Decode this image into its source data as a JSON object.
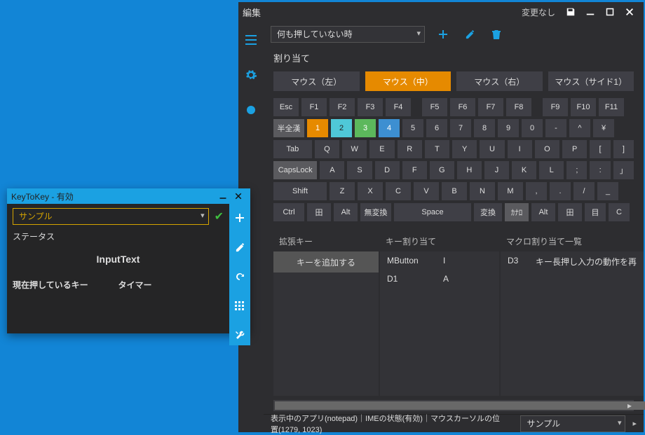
{
  "main": {
    "title": "編集",
    "change_status": "変更なし",
    "toolbar": {
      "layer_select": "何も押していない時"
    },
    "section_title": "割り当て",
    "mouse_tabs": {
      "left": "マウス（左）",
      "middle": "マウス（中）",
      "right": "マウス（右）",
      "side1": "マウス（サイド1）"
    },
    "keyboard": {
      "rows": [
        [
          {
            "l": "Esc",
            "w": 36
          },
          {
            "l": "F1",
            "w": 36
          },
          {
            "l": "F2",
            "w": 36
          },
          {
            "l": "F3",
            "w": 36
          },
          {
            "l": "F4",
            "w": 36
          },
          {
            "gap": 8
          },
          {
            "l": "F5",
            "w": 36
          },
          {
            "l": "F6",
            "w": 36
          },
          {
            "l": "F7",
            "w": 36
          },
          {
            "l": "F8",
            "w": 36
          },
          {
            "gap": 8
          },
          {
            "l": "F9",
            "w": 36
          },
          {
            "l": "F10",
            "w": 36
          },
          {
            "l": "F11",
            "w": 36
          }
        ],
        [
          {
            "l": "半全漢",
            "w": 44,
            "c": "light"
          },
          {
            "l": "1",
            "w": 30,
            "c": "orange"
          },
          {
            "l": "2",
            "w": 30,
            "c": "cyan"
          },
          {
            "l": "3",
            "w": 30,
            "c": "green"
          },
          {
            "l": "4",
            "w": 30,
            "c": "blue"
          },
          {
            "l": "5",
            "w": 30
          },
          {
            "l": "6",
            "w": 30
          },
          {
            "l": "7",
            "w": 30
          },
          {
            "l": "8",
            "w": 30
          },
          {
            "l": "9",
            "w": 30
          },
          {
            "l": "0",
            "w": 30
          },
          {
            "l": "-",
            "w": 30
          },
          {
            "l": "^",
            "w": 30
          },
          {
            "l": "¥",
            "w": 30
          }
        ],
        [
          {
            "l": "Tab",
            "w": 56
          },
          {
            "l": "Q",
            "w": 36
          },
          {
            "l": "W",
            "w": 36
          },
          {
            "l": "E",
            "w": 36
          },
          {
            "l": "R",
            "w": 36
          },
          {
            "l": "T",
            "w": 36
          },
          {
            "l": "Y",
            "w": 36
          },
          {
            "l": "U",
            "w": 36
          },
          {
            "l": "I",
            "w": 36
          },
          {
            "l": "O",
            "w": 36
          },
          {
            "l": "P",
            "w": 36
          },
          {
            "l": "[",
            "w": 30
          },
          {
            "l": "]",
            "w": 30
          }
        ],
        [
          {
            "l": "CapsLock",
            "w": 64,
            "c": "light"
          },
          {
            "l": "A",
            "w": 36
          },
          {
            "l": "S",
            "w": 36
          },
          {
            "l": "D",
            "w": 36
          },
          {
            "l": "F",
            "w": 36
          },
          {
            "l": "G",
            "w": 36
          },
          {
            "l": "H",
            "w": 36
          },
          {
            "l": "J",
            "w": 36
          },
          {
            "l": "K",
            "w": 36
          },
          {
            "l": "L",
            "w": 36
          },
          {
            "l": ";",
            "w": 30
          },
          {
            "l": ":",
            "w": 30
          },
          {
            "l": "」",
            "w": 30
          }
        ],
        [
          {
            "l": "Shift",
            "w": 76
          },
          {
            "l": "Z",
            "w": 36
          },
          {
            "l": "X",
            "w": 36
          },
          {
            "l": "C",
            "w": 36
          },
          {
            "l": "V",
            "w": 36
          },
          {
            "l": "B",
            "w": 36
          },
          {
            "l": "N",
            "w": 36
          },
          {
            "l": "M",
            "w": 36
          },
          {
            "l": ",",
            "w": 30
          },
          {
            "l": ".",
            "w": 30
          },
          {
            "l": "/",
            "w": 30
          },
          {
            "l": "_",
            "w": 30
          }
        ],
        [
          {
            "l": "Ctrl",
            "w": 44
          },
          {
            "l": "田",
            "w": 34
          },
          {
            "l": "Alt",
            "w": 34
          },
          {
            "l": "無変換",
            "w": 44
          },
          {
            "l": "Space",
            "w": 110
          },
          {
            "l": "変換",
            "w": 40
          },
          {
            "l": "ｶﾅﾛ",
            "w": 34,
            "c": "light"
          },
          {
            "l": "Alt",
            "w": 34
          },
          {
            "l": "田",
            "w": 34
          },
          {
            "l": "目",
            "w": 30
          },
          {
            "l": "C",
            "w": 30
          }
        ]
      ]
    },
    "panels": {
      "ext_keys_title": "拡張キー",
      "add_key_btn": "キーを追加する",
      "key_assign_title": "キー割り当て",
      "assigns": [
        {
          "k": "MButton",
          "v": "I"
        },
        {
          "k": "D1",
          "v": "A"
        }
      ],
      "macro_title": "マクロ割り当て一覧",
      "macros": [
        {
          "k": "D3",
          "v": "キー長押し入力の動作を再"
        }
      ]
    },
    "statusbar": {
      "text": "表示中のアプリ(notepad)｜IMEの状態(有効)｜マウスカーソルの位置(1279, 1023)",
      "profile": "サンプル"
    }
  },
  "mini": {
    "title": "KeyToKey - 有効",
    "profile": "サンプル",
    "status_label": "ステータス",
    "center": "InputText",
    "col1": "現在押しているキー",
    "col2": "タイマー"
  }
}
